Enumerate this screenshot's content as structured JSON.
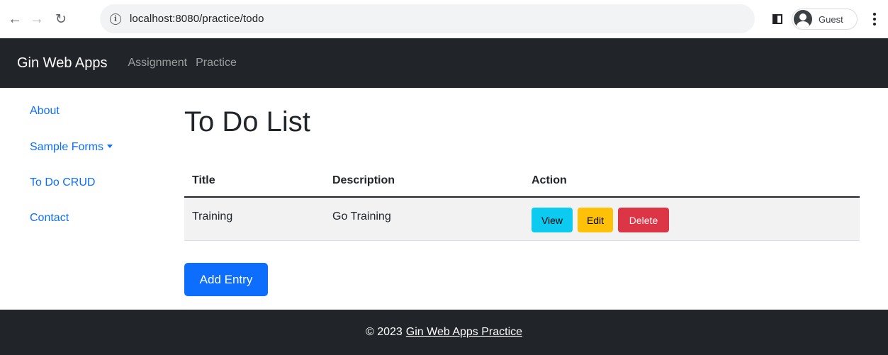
{
  "browser": {
    "url": "localhost:8080/practice/todo",
    "profile_label": "Guest",
    "icons": [
      "back-arrow-icon",
      "forward-arrow-icon",
      "reload-icon",
      "info-icon",
      "side-panel-icon",
      "profile-avatar-icon",
      "more-options-icon"
    ]
  },
  "navbar": {
    "brand": "Gin Web Apps",
    "links": [
      {
        "label": "Assignment"
      },
      {
        "label": "Practice"
      }
    ]
  },
  "sidebar": {
    "items": [
      {
        "label": "About"
      },
      {
        "label": "Sample Forms"
      },
      {
        "label": "To Do CRUD"
      },
      {
        "label": "Contact"
      }
    ]
  },
  "main": {
    "title": "To Do List",
    "table": {
      "headers": [
        "Title",
        "Description",
        "Action"
      ],
      "rows": [
        {
          "title": "Training",
          "description": "Go Training"
        }
      ],
      "actions": {
        "view": "View",
        "edit": "Edit",
        "delete": "Delete"
      }
    },
    "add_button": "Add Entry"
  },
  "footer": {
    "prefix": "© 2023",
    "link": "Gin Web Apps Practice"
  },
  "colors": {
    "navbar_bg": "#212529",
    "link": "#0d6efd",
    "primary": "#0d6efd",
    "info": "#0dcaf0",
    "warning": "#ffc107",
    "danger": "#dc3545"
  }
}
